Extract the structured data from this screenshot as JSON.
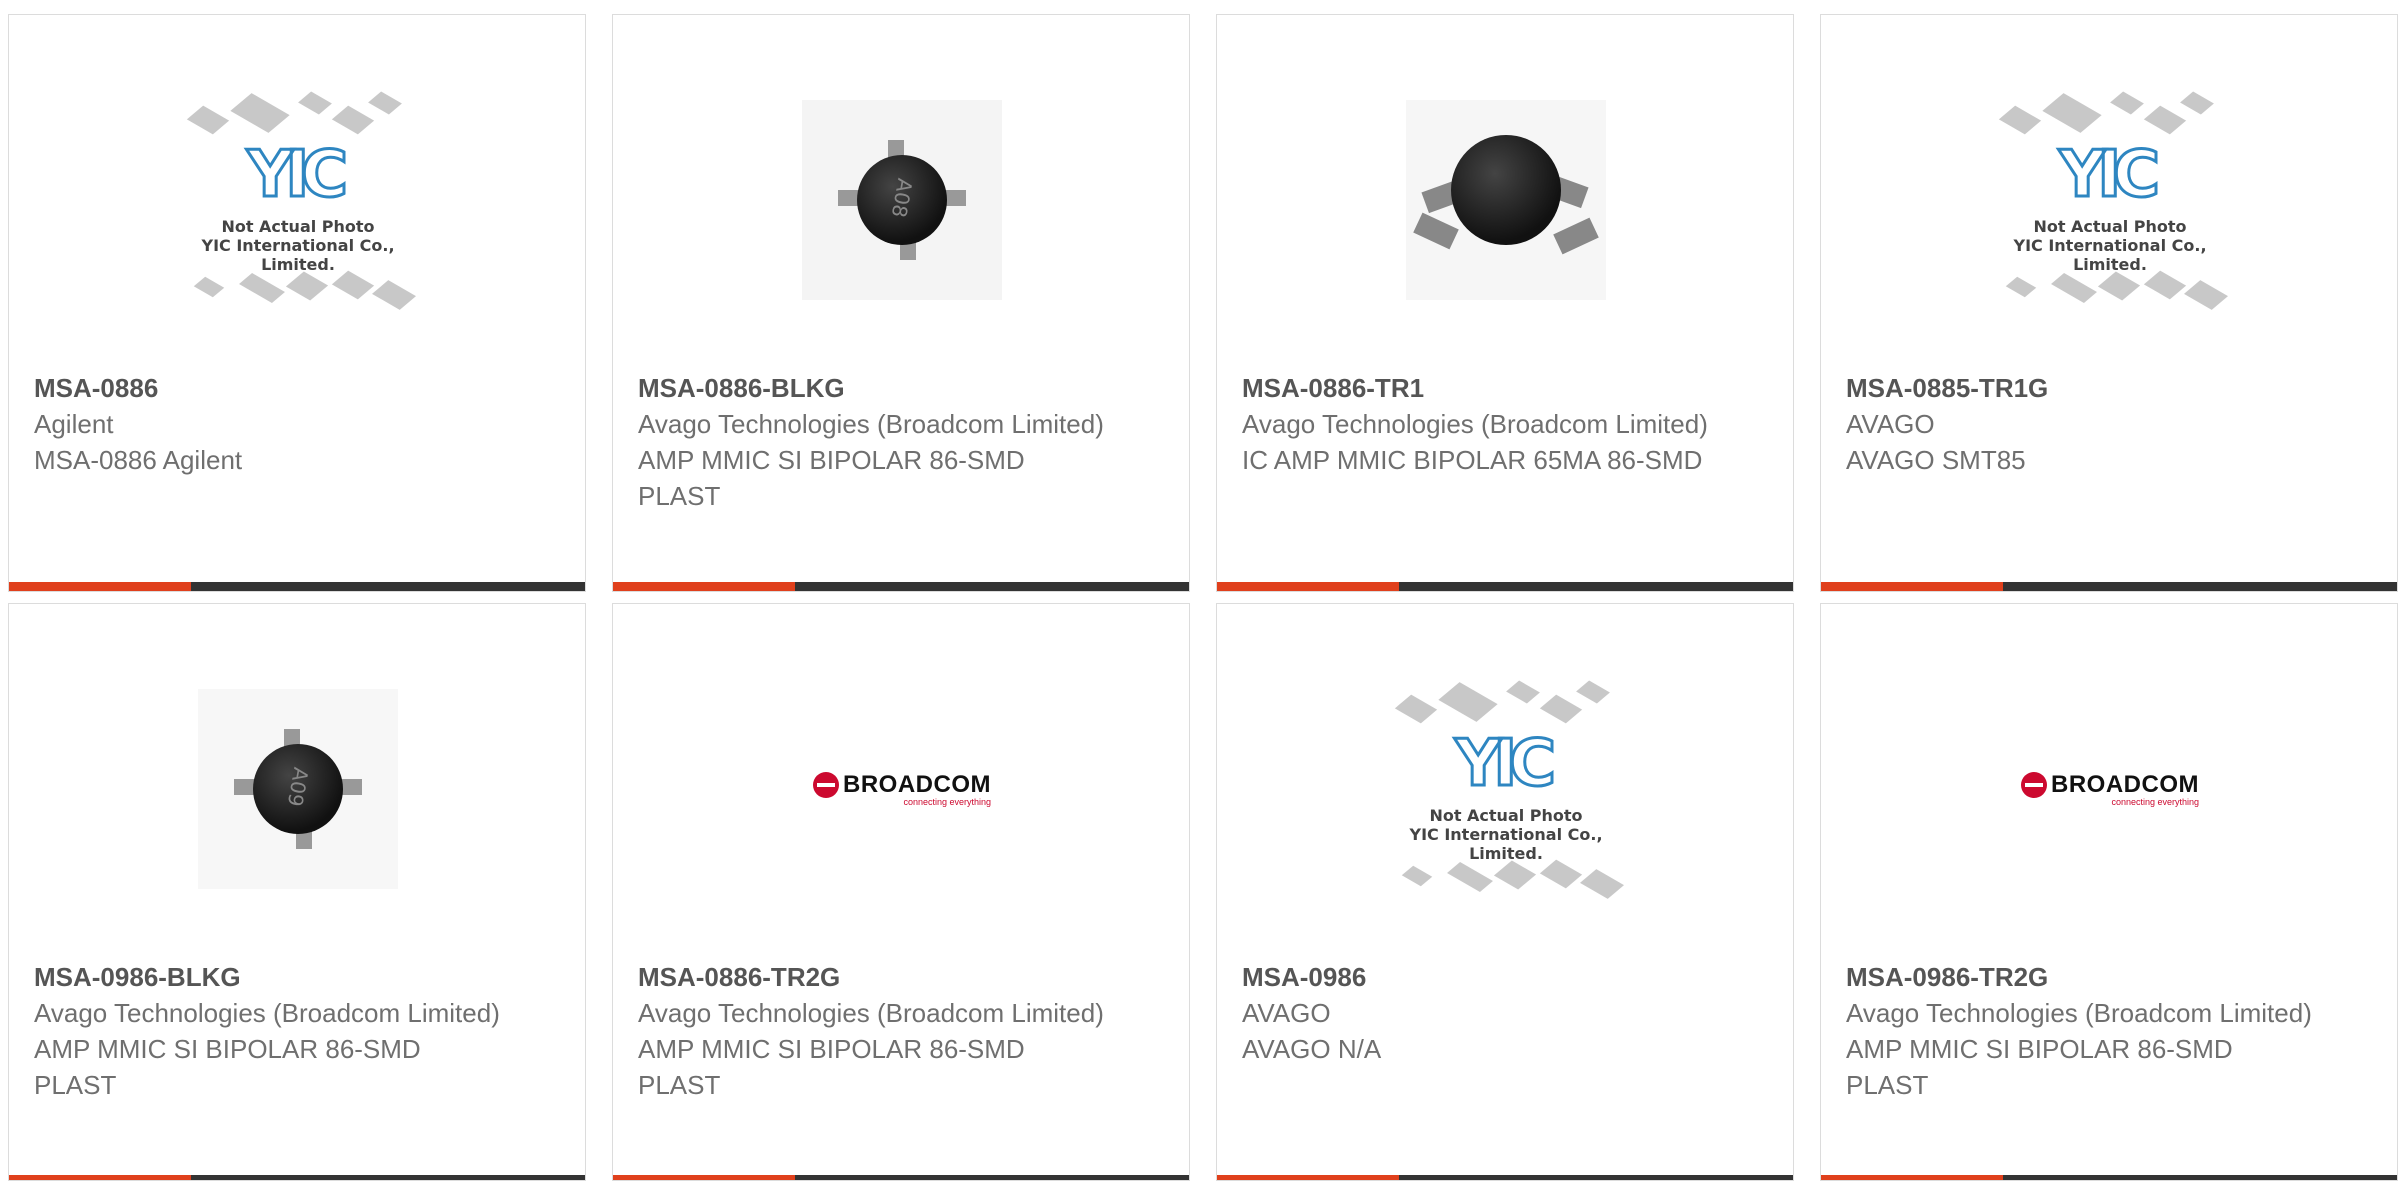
{
  "products": [
    {
      "part": "MSA-0886",
      "manufacturer": "Agilent",
      "description": "MSA-0886 Agilent",
      "image": "not-actual-photo"
    },
    {
      "part": "MSA-0886-BLKG",
      "manufacturer": "Avago Technologies (Broadcom Limited)",
      "description": "AMP MMIC SI BIPOLAR 86-SMD PLAST",
      "image": "photo-a08"
    },
    {
      "part": "MSA-0886-TR1",
      "manufacturer": "Avago Technologies (Broadcom Limited)",
      "description": "IC AMP MMIC BIPOLAR 65MA 86-SMD",
      "image": "photo-black"
    },
    {
      "part": "MSA-0885-TR1G",
      "manufacturer": "AVAGO",
      "description": "AVAGO SMT85",
      "image": "not-actual-photo"
    },
    {
      "part": "MSA-0986-BLKG",
      "manufacturer": "Avago Technologies (Broadcom Limited)",
      "description": "AMP MMIC SI BIPOLAR 86-SMD PLAST",
      "image": "photo-a09"
    },
    {
      "part": "MSA-0886-TR2G",
      "manufacturer": "Avago Technologies (Broadcom Limited)",
      "description": "AMP MMIC SI BIPOLAR 86-SMD PLAST",
      "image": "broadcom-logo"
    },
    {
      "part": "MSA-0986",
      "manufacturer": "AVAGO",
      "description": "AVAGO N/A",
      "image": "not-actual-photo"
    },
    {
      "part": "MSA-0986-TR2G",
      "manufacturer": "Avago Technologies (Broadcom Limited)",
      "description": "AMP MMIC SI BIPOLAR 86-SMD PLAST",
      "image": "broadcom-logo"
    }
  ],
  "placeholder": {
    "logo_text": "YIC",
    "caption_line1": "Not Actual Photo",
    "caption_line2": "YIC International Co., Limited."
  },
  "photo_codes": {
    "a08": "A08",
    "a09": "A09"
  },
  "broadcom": {
    "word": "BROADCOM",
    "tagline": "connecting everything"
  },
  "colors": {
    "accent": "#e0401c",
    "bar": "#333333",
    "border": "#dcdcdc",
    "brand_red": "#cc092f"
  }
}
